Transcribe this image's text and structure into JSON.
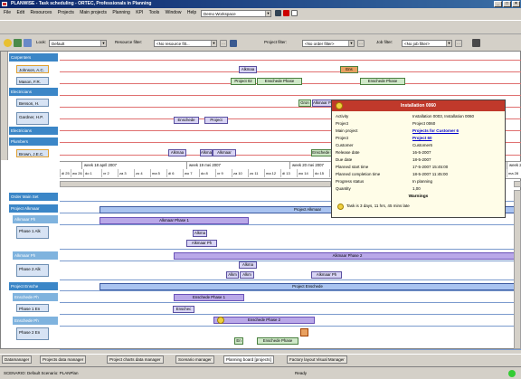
{
  "title": "PLANWISE - Task scheduling - ORTEC, Professionals in Planning",
  "menu": [
    "File",
    "Edit",
    "Resources",
    "Projects",
    "Main projects",
    "Planning",
    "KPI",
    "Tools",
    "Window",
    "Help"
  ],
  "workspace": "Demo Workspace",
  "toolbar": {
    "look_label": "Look:",
    "look_value": "Default",
    "resource_filter_label": "Resource filter:",
    "resource_filter_value": "<No resource filt...",
    "project_filter_label": "Project filter:",
    "project_filter_value": "<No order filter>",
    "job_filter_label": "Job filter:",
    "job_filter_value": "<No job filter>"
  },
  "resource_groups": [
    {
      "label": "Carpenters",
      "kind": "hdr"
    },
    {
      "label": "Johnson, A.C.",
      "kind": "res"
    },
    {
      "label": "Mason, F.R.",
      "kind": "res"
    },
    {
      "label": "Electricians",
      "kind": "hdr"
    },
    {
      "label": "Benson, H.",
      "kind": "res"
    },
    {
      "label": "Gardner, H.P.",
      "kind": "res"
    },
    {
      "label": "Electricians",
      "kind": "hdr"
    },
    {
      "label": "Plumbers",
      "kind": "hdr"
    },
    {
      "label": "Brown, J.E.C.",
      "kind": "res"
    }
  ],
  "resource_bars": [
    {
      "label": "Alkmaa",
      "color": "lav"
    },
    {
      "label": "Ens",
      "color": "green"
    },
    {
      "label": "Project 02",
      "color": "green"
    },
    {
      "label": "Enschede Phase",
      "color": "green"
    },
    {
      "label": "Enschede Phase",
      "color": "green"
    },
    {
      "label": "Gron",
      "color": "green"
    },
    {
      "label": "Alkmaar Pha",
      "color": "lav"
    },
    {
      "label": "Enschede",
      "color": "lav"
    },
    {
      "label": "Project",
      "color": "lav"
    },
    {
      "label": "Alkmaa",
      "color": "lav"
    },
    {
      "label": "Alkma",
      "color": "lav"
    },
    {
      "label": "Alkmaar",
      "color": "lav"
    },
    {
      "label": "Enschede Ph",
      "color": "green"
    }
  ],
  "timeline": {
    "weeks": [
      "week 18 april 2007",
      "week 19 mei 2007",
      "week 20 mei 2007",
      "week 22"
    ],
    "days": [
      "di 25",
      "wo 26",
      "do 1",
      "vr 2",
      "za 3",
      "zo 4",
      "ma 5",
      "di 6",
      "wo 7",
      "do 8",
      "vr 9",
      "za 10",
      "zo 11",
      "ma 12",
      "di 13",
      "wo 14",
      "do 15",
      "vr 16",
      "za 17",
      "zo 18",
      "ma 19",
      "di 20",
      "wo 21",
      "do 22",
      "vr 23",
      "ma 28"
    ]
  },
  "project_groups": [
    {
      "label": "Order Main Set",
      "kind": "hdr"
    },
    {
      "label": "Project Alkmaar",
      "kind": "hdr"
    },
    {
      "label": "Alkmaar Ph",
      "kind": "sub"
    },
    {
      "label": "Phase 1 Alk",
      "kind": "res"
    },
    {
      "label": "Alkmaar Ph",
      "kind": "sub"
    },
    {
      "label": "Phase 2 Alk",
      "kind": "res"
    },
    {
      "label": "Project Ensche",
      "kind": "hdr"
    },
    {
      "label": "Enschede Ph",
      "kind": "sub"
    },
    {
      "label": "Phase 1 En",
      "kind": "res"
    },
    {
      "label": "Enschede Ph",
      "kind": "sub"
    },
    {
      "label": "Phase 2 En",
      "kind": "res"
    }
  ],
  "project_bars": [
    {
      "label": "Project Alkmaar",
      "color": "blue"
    },
    {
      "label": "Alkmaar Phase 1",
      "color": "purple"
    },
    {
      "label": "Alkma",
      "color": "lav"
    },
    {
      "label": "Alkmaar Ph",
      "color": "lav"
    },
    {
      "label": "Alkmaar Phase 2",
      "color": "purple"
    },
    {
      "label": "Alkma",
      "color": "lav"
    },
    {
      "label": "Alkm",
      "color": "lav"
    },
    {
      "label": "Alkm",
      "color": "lav"
    },
    {
      "label": "Alkmaar Ph",
      "color": "lav"
    },
    {
      "label": "Project Enschede",
      "color": "blue"
    },
    {
      "label": "Enschede Phase 1",
      "color": "purple"
    },
    {
      "label": "Enschec",
      "color": "lav"
    },
    {
      "label": "Enschede Phase 2",
      "color": "purple"
    },
    {
      "label": "En",
      "color": "green"
    },
    {
      "label": "Enschede Phase",
      "color": "green"
    }
  ],
  "popup": {
    "title": "Installation 0060",
    "rows": [
      {
        "k": "Activity",
        "v": "Installation 0003, Installation 0060",
        "link": false
      },
      {
        "k": "Project",
        "v": "Project 0060",
        "link": false
      },
      {
        "k": "Main project",
        "v": "Projects for Customer 6",
        "link": true
      },
      {
        "k": "Project",
        "v": "Project 60",
        "link": true
      },
      {
        "k": "Customer",
        "v": "Customer6",
        "link": false
      },
      {
        "k": "Release date",
        "v": "16-5-2007",
        "link": false
      },
      {
        "k": "Due date",
        "v": "18-5-2007",
        "link": false
      },
      {
        "k": "Planned start time",
        "v": "17-5-2007 15:45:00",
        "link": false
      },
      {
        "k": "Planned completion time",
        "v": "18-5-2007 11:45:00",
        "link": false
      },
      {
        "k": "Progress status",
        "v": "In planning",
        "link": false
      },
      {
        "k": "Quantity",
        "v": "1,00",
        "link": false
      }
    ],
    "warnings_label": "Warnings",
    "warning_text": "Task is 3 days, 11 hrs, 45 mins late"
  },
  "tabs": [
    "Datamanager",
    "Projects data manager",
    "Project charts data manager",
    "Scenario manager",
    "Planning board [projects]",
    "Factory layout Visual Manager"
  ],
  "status": {
    "left": "SCENARIO: Default Scenario: PLANPlan",
    "mid": "Ready"
  }
}
